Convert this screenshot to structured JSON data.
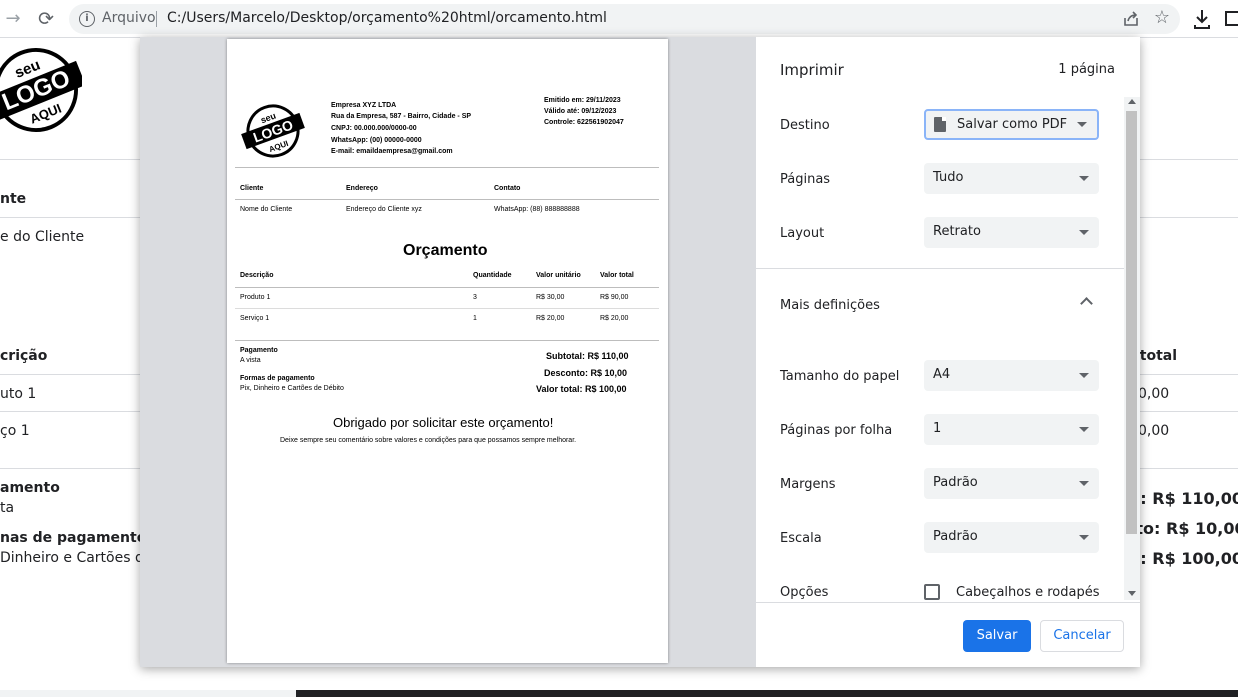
{
  "browser": {
    "scheme_label": "Arquivo",
    "url": "C:/Users/Marcelo/Desktop/orçamento%20html/orcamento.html"
  },
  "background": {
    "client_header": "nte",
    "client_value": "e do Cliente",
    "desc_header": "crição",
    "total_header": "r total",
    "row1_desc": "uto 1",
    "row1_total": "0,00",
    "row2_desc": "ço 1",
    "row2_total": "0,00",
    "payment_title": "amento",
    "payment_value": "ta",
    "forms_title": "nas de pagamento",
    "forms_value": "Dinheiro e Cartões de I",
    "subtotal": "al: R$ 110,00",
    "discount": "nto: R$ 10,00",
    "total": "al: R$ 100,00"
  },
  "document": {
    "logo_top": "seu",
    "logo_mid": "LOGO",
    "logo_bot": "AQUI",
    "company": {
      "name": "Empresa XYZ LTDA",
      "address": "Rua da Empresa, 587 - Bairro, Cidade - SP",
      "cnpj": "CNPJ: 00.000.000/0000-00",
      "whatsapp": "WhatsApp: (00) 00000-0000",
      "email": "E-mail: emaildaempresa@gmail.com"
    },
    "emitted": "Emitido em: 29/11/2023",
    "valid": "Válido até: 09/12/2023",
    "control": "Controle: 622561902047",
    "client_headers": [
      "Cliente",
      "Endereço",
      "Contato"
    ],
    "client_values": [
      "Nome do Cliente",
      "Endereço do Cliente xyz",
      "WhatsApp: (88) 888888888"
    ],
    "title": "Orçamento",
    "table_headers": [
      "Descrição",
      "Quantidade",
      "Valor unitário",
      "Valor total"
    ],
    "rows": [
      [
        "Produto 1",
        "3",
        "R$ 30,00",
        "R$ 90,00"
      ],
      [
        "Serviço 1",
        "1",
        "R$ 20,00",
        "R$ 20,00"
      ]
    ],
    "payment_title": "Pagamento",
    "payment_value": "A vista",
    "forms_title": "Formas de pagamento",
    "forms_value": "Pix, Dinheiro e Cartões de Débito",
    "subtotal": "Subtotal: R$ 110,00",
    "discount": "Desconto: R$ 10,00",
    "total": "Valor total: R$ 100,00",
    "thanks": "Obrigado por solicitar este orçamento!",
    "footer": "Deixe sempre seu comentário sobre valores e condições para que possamos sempre melhorar."
  },
  "print": {
    "title": "Imprimir",
    "page_count": "1 página",
    "destination_label": "Destino",
    "destination_value": "Salvar como PDF",
    "pages_label": "Páginas",
    "pages_value": "Tudo",
    "layout_label": "Layout",
    "layout_value": "Retrato",
    "more_settings": "Mais definições",
    "paper_label": "Tamanho do papel",
    "paper_value": "A4",
    "per_sheet_label": "Páginas por folha",
    "per_sheet_value": "1",
    "margins_label": "Margens",
    "margins_value": "Padrão",
    "scale_label": "Escala",
    "scale_value": "Padrão",
    "options_label": "Opções",
    "headers_footers": "Cabeçalhos e rodapés",
    "save": "Salvar",
    "cancel": "Cancelar"
  },
  "colors": {
    "accent": "#1a73e8",
    "preview_bg": "#dadce0"
  }
}
